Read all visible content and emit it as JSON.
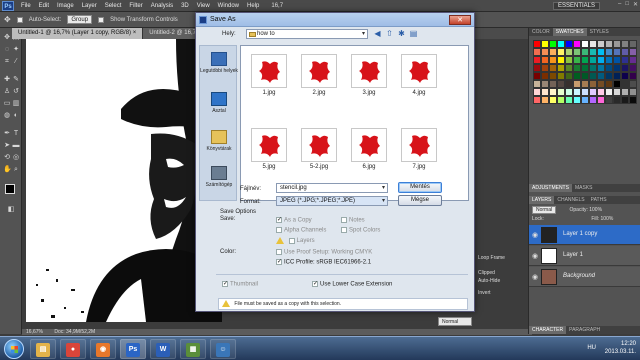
{
  "app": {
    "logo": "Ps",
    "menus": [
      "File",
      "Edit",
      "Image",
      "Layer",
      "Select",
      "Filter",
      "Analysis",
      "3D",
      "View",
      "Window",
      "Help"
    ],
    "zoom": "16,7",
    "workspace": "ESSENTIALS",
    "options": {
      "auto_select_label": "Auto-Select:",
      "auto_select_value": "Group",
      "transform_label": "Show Transform Controls"
    },
    "tabs": [
      {
        "label": "Untitled-1 @ 16,7% (Layer 1 copy, RGB/8) ×"
      },
      {
        "label": "Untitled-2 @ 16,7% (Layer 1 copy, RGB/8) ×"
      }
    ],
    "status": {
      "zoom": "16,67%",
      "doc": "Doc: 34,9M/52,2M"
    }
  },
  "dialog": {
    "title": "Save As",
    "close": "✕",
    "hely_label": "Hely:",
    "folder": "how to",
    "places": [
      {
        "label": "Legutóbbi helyek",
        "icon": "recent-places-icon"
      },
      {
        "label": "Asztal",
        "icon": "desktop-icon"
      },
      {
        "label": "Könyvtárak",
        "icon": "libraries-icon"
      },
      {
        "label": "Számítógép",
        "icon": "computer-icon"
      }
    ],
    "files": [
      "1.jpg",
      "2.jpg",
      "3.jpg",
      "4.jpg",
      "5.jpg",
      "5-2.jpg",
      "6.jpg",
      "7.jpg"
    ],
    "filename_label": "Fájlnév:",
    "filename_value": "stencil.jpg",
    "format_label": "Format:",
    "format_value": "JPEG (*.JPG;*.JPEG;*.JPE)",
    "save_button": "Mentés",
    "cancel_button": "Mégse",
    "save_options_title": "Save Options",
    "save_label": "Save:",
    "as_copy": "As a Copy",
    "notes": "Notes",
    "alpha_channels": "Alpha Channels",
    "spot_colors": "Spot Colors",
    "layers": "Layers",
    "color_label": "Color:",
    "use_proof": "Use Proof Setup:  Working CMYK",
    "icc_profile": "ICC Profile:  sRGB IEC61966-2.1",
    "thumbnail": "Thumbnail",
    "lower_case": "Use Lower Case Extension",
    "warning": "File must be saved as a copy with this selection."
  },
  "panels": {
    "swatch_tabs": [
      "COLOR",
      "SWATCHES",
      "STYLES"
    ],
    "adjust_tabs": [
      "ADJUSTMENTS",
      "MASKS"
    ],
    "layer_tabs": [
      "LAYERS",
      "CHANNELS",
      "PATHS"
    ],
    "blend_mode": "Normal",
    "opacity_label": "Opacity:",
    "opacity_value": "100%",
    "lock_label": "Lock:",
    "fill_label": "Fill:",
    "fill_value": "100%",
    "layers": [
      {
        "name": "Layer 1 copy",
        "selected": true
      },
      {
        "name": "Layer 1",
        "selected": false
      },
      {
        "name": "Background",
        "selected": false
      }
    ]
  },
  "misc": {
    "normal": "Normal",
    "loop_frame": "Loop Frame",
    "clipped": "Clipped",
    "auto_hide": "Auto-Hide",
    "invert": "Invert",
    "char_tabs": [
      "CHARACTER",
      "PARAGRAPH"
    ]
  },
  "taskbar": {
    "lang": "HU",
    "time": "12:20",
    "date": "2013.03.11.",
    "apps": [
      {
        "name": "explorer-app",
        "glyph": "▤"
      },
      {
        "name": "chrome-app",
        "glyph": "●"
      },
      {
        "name": "firefox-app",
        "glyph": "◉"
      },
      {
        "name": "photoshop-app",
        "glyph": "Ps"
      },
      {
        "name": "word-app",
        "glyph": "W"
      },
      {
        "name": "network-app",
        "glyph": "▦"
      },
      {
        "name": "people-app",
        "glyph": "☺"
      }
    ]
  },
  "colors": {
    "stencil_red": "#d7131a",
    "selection_blue": "#2d6bc7"
  }
}
